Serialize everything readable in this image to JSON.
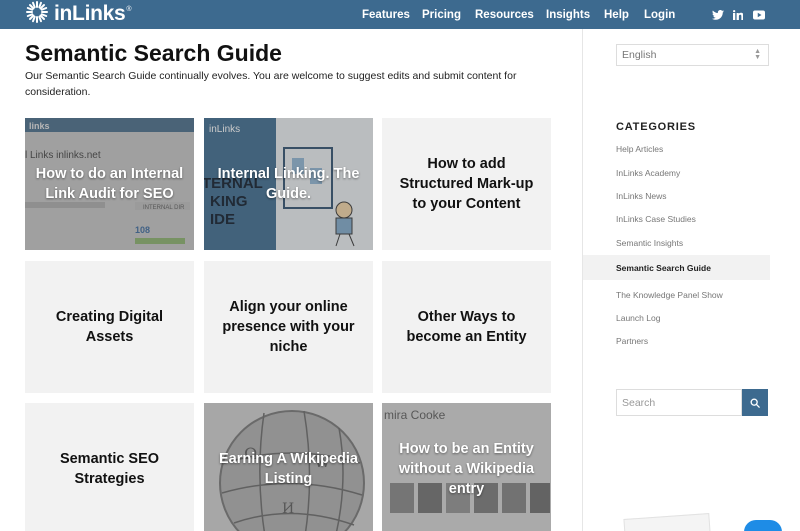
{
  "header": {
    "logo_text": "inLinks",
    "logo_mark": "®",
    "nav": [
      "Features",
      "Pricing",
      "Resources",
      "Insights",
      "Help",
      "Login"
    ],
    "social_icons": [
      "twitter-icon",
      "linkedin-icon",
      "youtube-icon"
    ],
    "colors": {
      "bar": "#3d6a8f",
      "text": "#ffffff"
    }
  },
  "main": {
    "title": "Semantic Search Guide",
    "intro": "Our Semantic Search Guide continually evolves. You are welcome to suggest edits and submit content for consideration.",
    "cards": [
      {
        "title": "How to do an Internal Link Audit for SEO",
        "has_image": true
      },
      {
        "title": "Internal Linking. The Guide.",
        "has_image": true
      },
      {
        "title": "How to add Structured Mark-up to your Content",
        "has_image": false
      },
      {
        "title": "Creating Digital Assets",
        "has_image": false
      },
      {
        "title": "Align your online presence with your niche",
        "has_image": false
      },
      {
        "title": "Other Ways to become an Entity",
        "has_image": false
      },
      {
        "title": "Semantic SEO Strategies",
        "has_image": false
      },
      {
        "title": "Earning A Wikipedia Listing",
        "has_image": true
      },
      {
        "title": "How to be an Entity without a Wikipedia entry",
        "has_image": true
      }
    ],
    "card_image_text": {
      "audit": [
        "l Links inlinks.net",
        "108",
        "INTERNAL DIR"
      ],
      "guide": [
        "inLinks",
        "TERNAL",
        "KING",
        "IDE"
      ],
      "entity": [
        "mira Cooke"
      ]
    }
  },
  "sidebar": {
    "language": "English",
    "categories_heading": "CATEGORIES",
    "categories": [
      "Help Articles",
      "InLinks Academy",
      "InLinks News",
      "InLinks Case Studies",
      "Semantic Insights",
      "Semantic Search Guide",
      "The Knowledge Panel Show",
      "Launch Log",
      "Partners"
    ],
    "active_category": "Semantic Search Guide",
    "search_placeholder": "Search",
    "colors": {
      "accent": "#3d6a8f"
    }
  }
}
